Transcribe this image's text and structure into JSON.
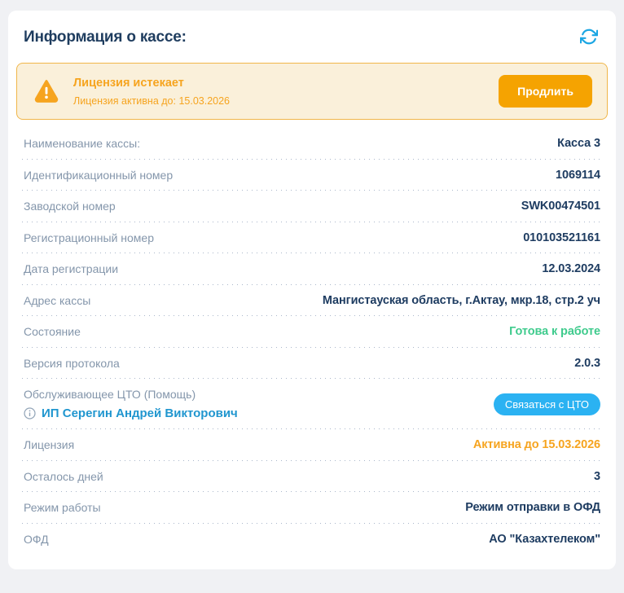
{
  "card": {
    "title": "Информация о кассе:"
  },
  "banner": {
    "title": "Лицензия истекает",
    "subtitle": "Лицензия активна до: 15.03.2026",
    "extend_button": "Продлить"
  },
  "fields": [
    {
      "label": "Наименование кассы:",
      "value": "Касса 3"
    },
    {
      "label": "Идентификационный номер",
      "value": "1069114"
    },
    {
      "label": "Заводской номер",
      "value": "SWK00474501"
    },
    {
      "label": "Регистрационный номер",
      "value": "010103521161"
    },
    {
      "label": "Дата регистрации",
      "value": "12.03.2024"
    },
    {
      "label": "Адрес кассы",
      "value": "Мангистауская область, г.Актау, мкр.18, стр.2 уч"
    },
    {
      "label": "Состояние",
      "value": "Готова к работе",
      "status": "green"
    },
    {
      "label": "Версия протокола",
      "value": "2.0.3"
    },
    {
      "label": "Обслуживающее ЦТО (Помощь)",
      "value": "ИП Серегин Андрей Викторович",
      "button_label": "Связаться с ЦТО"
    },
    {
      "label": "Лицензия",
      "value": "Активна до 15.03.2026",
      "status": "orange"
    },
    {
      "label": "Осталось дней",
      "value": "3"
    },
    {
      "label": "Режим работы",
      "value": "Режим отправки в ОФД"
    },
    {
      "label": "ОФД",
      "value": "АО \"Казахтелеком\""
    }
  ],
  "icons": {
    "refresh": "refresh-icon",
    "warning": "warning-triangle-icon",
    "info": "info-circle-icon"
  },
  "colors": {
    "accent_blue": "#2bb2f2",
    "link_blue": "#2096cf",
    "warn_orange": "#f6a41f",
    "button_orange": "#f5a301",
    "success_green": "#3fcb8d",
    "navy": "#1e3c61",
    "label_slate": "#8496ab",
    "banner_bg": "#faf0da"
  }
}
